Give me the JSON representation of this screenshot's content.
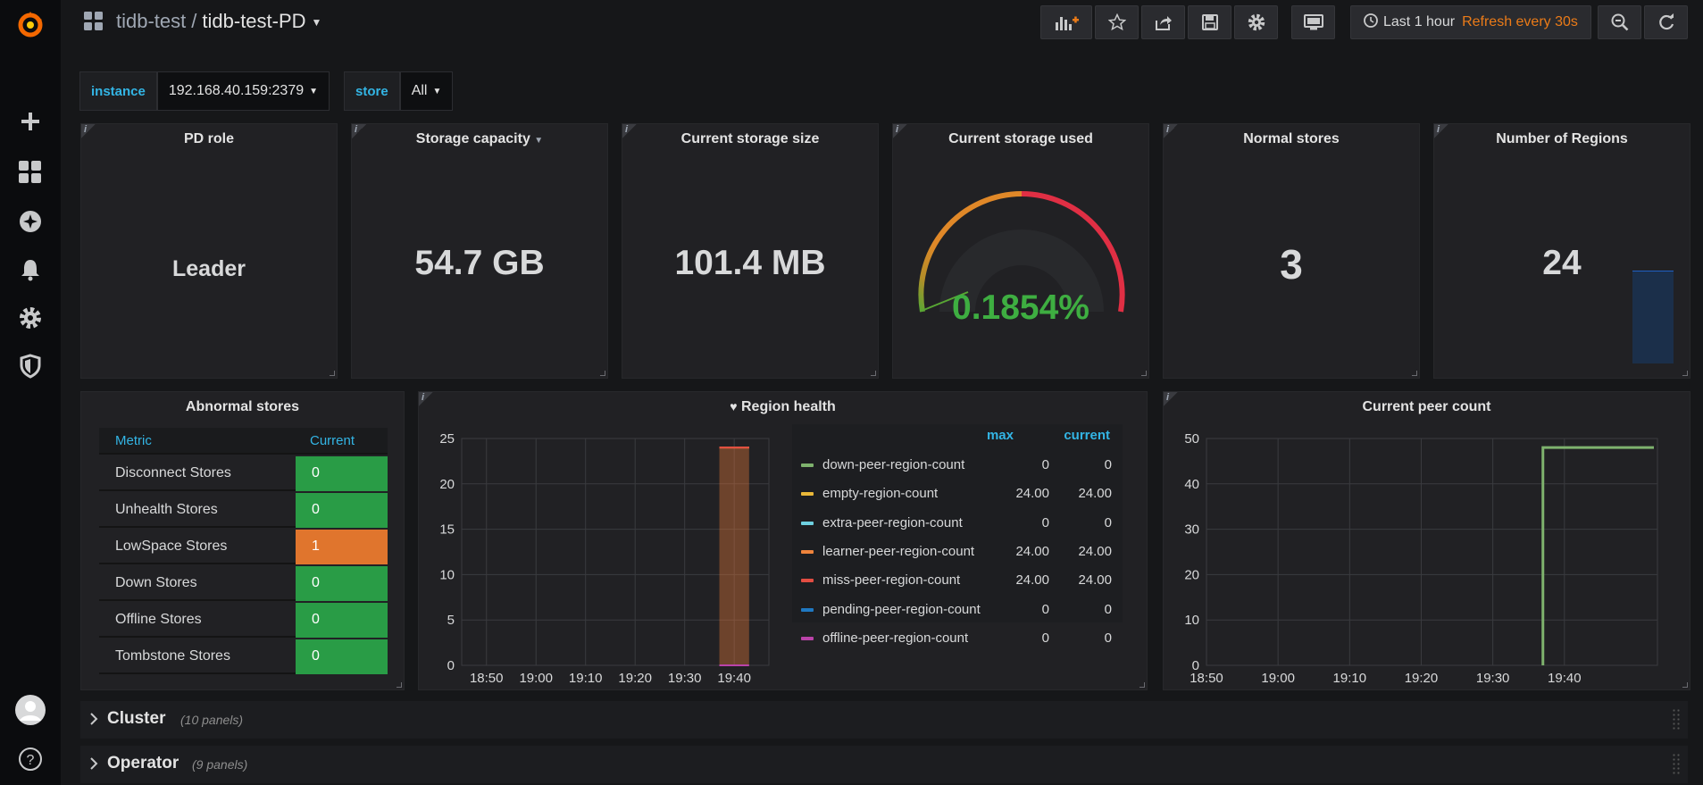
{
  "sidebar": {
    "icons": [
      "grafana-logo-icon",
      "plus-icon",
      "dashboards-icon",
      "explore-icon",
      "alerting-bell-icon",
      "configuration-gear-icon",
      "server-admin-shield-icon",
      "user-avatar-icon",
      "help-icon"
    ]
  },
  "header": {
    "folder": "tidb-test",
    "separator": "/",
    "title": "tidb-test-PD",
    "buttons": [
      "add-panel-icon",
      "star-icon",
      "share-icon",
      "save-icon",
      "settings-icon",
      "tv-mode-icon",
      "zoom-out-icon",
      "refresh-icon"
    ],
    "time_range": "Last 1 hour",
    "refresh": "Refresh every 30s"
  },
  "variables": [
    {
      "label": "instance",
      "value": "192.168.40.159:2379"
    },
    {
      "label": "store",
      "value": "All"
    }
  ],
  "stats": {
    "pd_role": {
      "title": "PD role",
      "value": "Leader"
    },
    "storage_capacity": {
      "title": "Storage capacity",
      "value": "54.7 GB"
    },
    "current_storage_size": {
      "title": "Current storage size",
      "value": "101.4 MB"
    },
    "current_storage_used": {
      "title": "Current storage used",
      "value": "0.1854%",
      "gauge_fraction": 0.001854
    },
    "normal_stores": {
      "title": "Normal stores",
      "value": "3"
    },
    "number_of_regions": {
      "title": "Number of Regions",
      "value": "24"
    }
  },
  "abnormal_stores": {
    "title": "Abnormal stores",
    "columns": [
      "Metric",
      "Current"
    ],
    "rows": [
      {
        "metric": "Disconnect Stores",
        "current": "0",
        "color": "#299c46"
      },
      {
        "metric": "Unhealth Stores",
        "current": "0",
        "color": "#299c46"
      },
      {
        "metric": "LowSpace Stores",
        "current": "1",
        "color": "#e0752d"
      },
      {
        "metric": "Down Stores",
        "current": "0",
        "color": "#299c46"
      },
      {
        "metric": "Offline Stores",
        "current": "0",
        "color": "#299c46"
      },
      {
        "metric": "Tombstone Stores",
        "current": "0",
        "color": "#299c46"
      }
    ]
  },
  "region_health": {
    "title": "Region health",
    "legend_headers": {
      "max": "max",
      "current": "current"
    },
    "legend": [
      {
        "name": "down-peer-region-count",
        "max": "0",
        "current": "0",
        "color": "#7eb26d"
      },
      {
        "name": "empty-region-count",
        "max": "24.00",
        "current": "24.00",
        "color": "#eab839"
      },
      {
        "name": "extra-peer-region-count",
        "max": "0",
        "current": "0",
        "color": "#6ed0e0"
      },
      {
        "name": "learner-peer-region-count",
        "max": "24.00",
        "current": "24.00",
        "color": "#ef843c"
      },
      {
        "name": "miss-peer-region-count",
        "max": "24.00",
        "current": "24.00",
        "color": "#e24d42"
      },
      {
        "name": "pending-peer-region-count",
        "max": "0",
        "current": "0",
        "color": "#1f78c1"
      },
      {
        "name": "offline-peer-region-count",
        "max": "0",
        "current": "0",
        "color": "#ba43a9"
      }
    ]
  },
  "peer_count": {
    "title": "Current peer count"
  },
  "chart_data": [
    {
      "type": "area",
      "title": "Region health",
      "x_ticks": [
        "18:50",
        "19:00",
        "19:10",
        "19:20",
        "19:30",
        "19:40"
      ],
      "y_ticks": [
        "0",
        "5",
        "10",
        "15",
        "20",
        "25"
      ],
      "ylim": [
        0,
        25
      ],
      "grid": true,
      "legend_placement": "right",
      "series": [
        {
          "name": "empty-region-count",
          "color": "#eab839",
          "x": [
            "19:37",
            "19:38"
          ],
          "y": [
            24,
            24
          ]
        },
        {
          "name": "learner-peer-region-count",
          "color": "#ef843c",
          "x": [
            "19:37",
            "19:38"
          ],
          "y": [
            24,
            24
          ]
        },
        {
          "name": "miss-peer-region-count",
          "color": "#e24d42",
          "x": [
            "19:37",
            "19:38"
          ],
          "y": [
            24,
            24
          ]
        }
      ]
    },
    {
      "type": "line",
      "title": "Current peer count",
      "x_ticks": [
        "18:50",
        "19:00",
        "19:10",
        "19:20",
        "19:30",
        "19:40"
      ],
      "y_ticks": [
        "0",
        "10",
        "20",
        "30",
        "40",
        "50"
      ],
      "ylim": [
        0,
        50
      ],
      "grid": true,
      "series": [
        {
          "color": "#7eb26d",
          "x": [
            "19:37",
            "19:37",
            "19:50"
          ],
          "y": [
            0,
            48,
            48
          ]
        }
      ]
    },
    {
      "type": "bar",
      "title": "Number of Regions",
      "series": [
        {
          "color": "#1f60c4",
          "values": [
            24
          ]
        }
      ]
    }
  ],
  "rows": [
    {
      "title": "Cluster",
      "count": "(10 panels)"
    },
    {
      "title": "Operator",
      "count": "(9 panels)"
    }
  ]
}
